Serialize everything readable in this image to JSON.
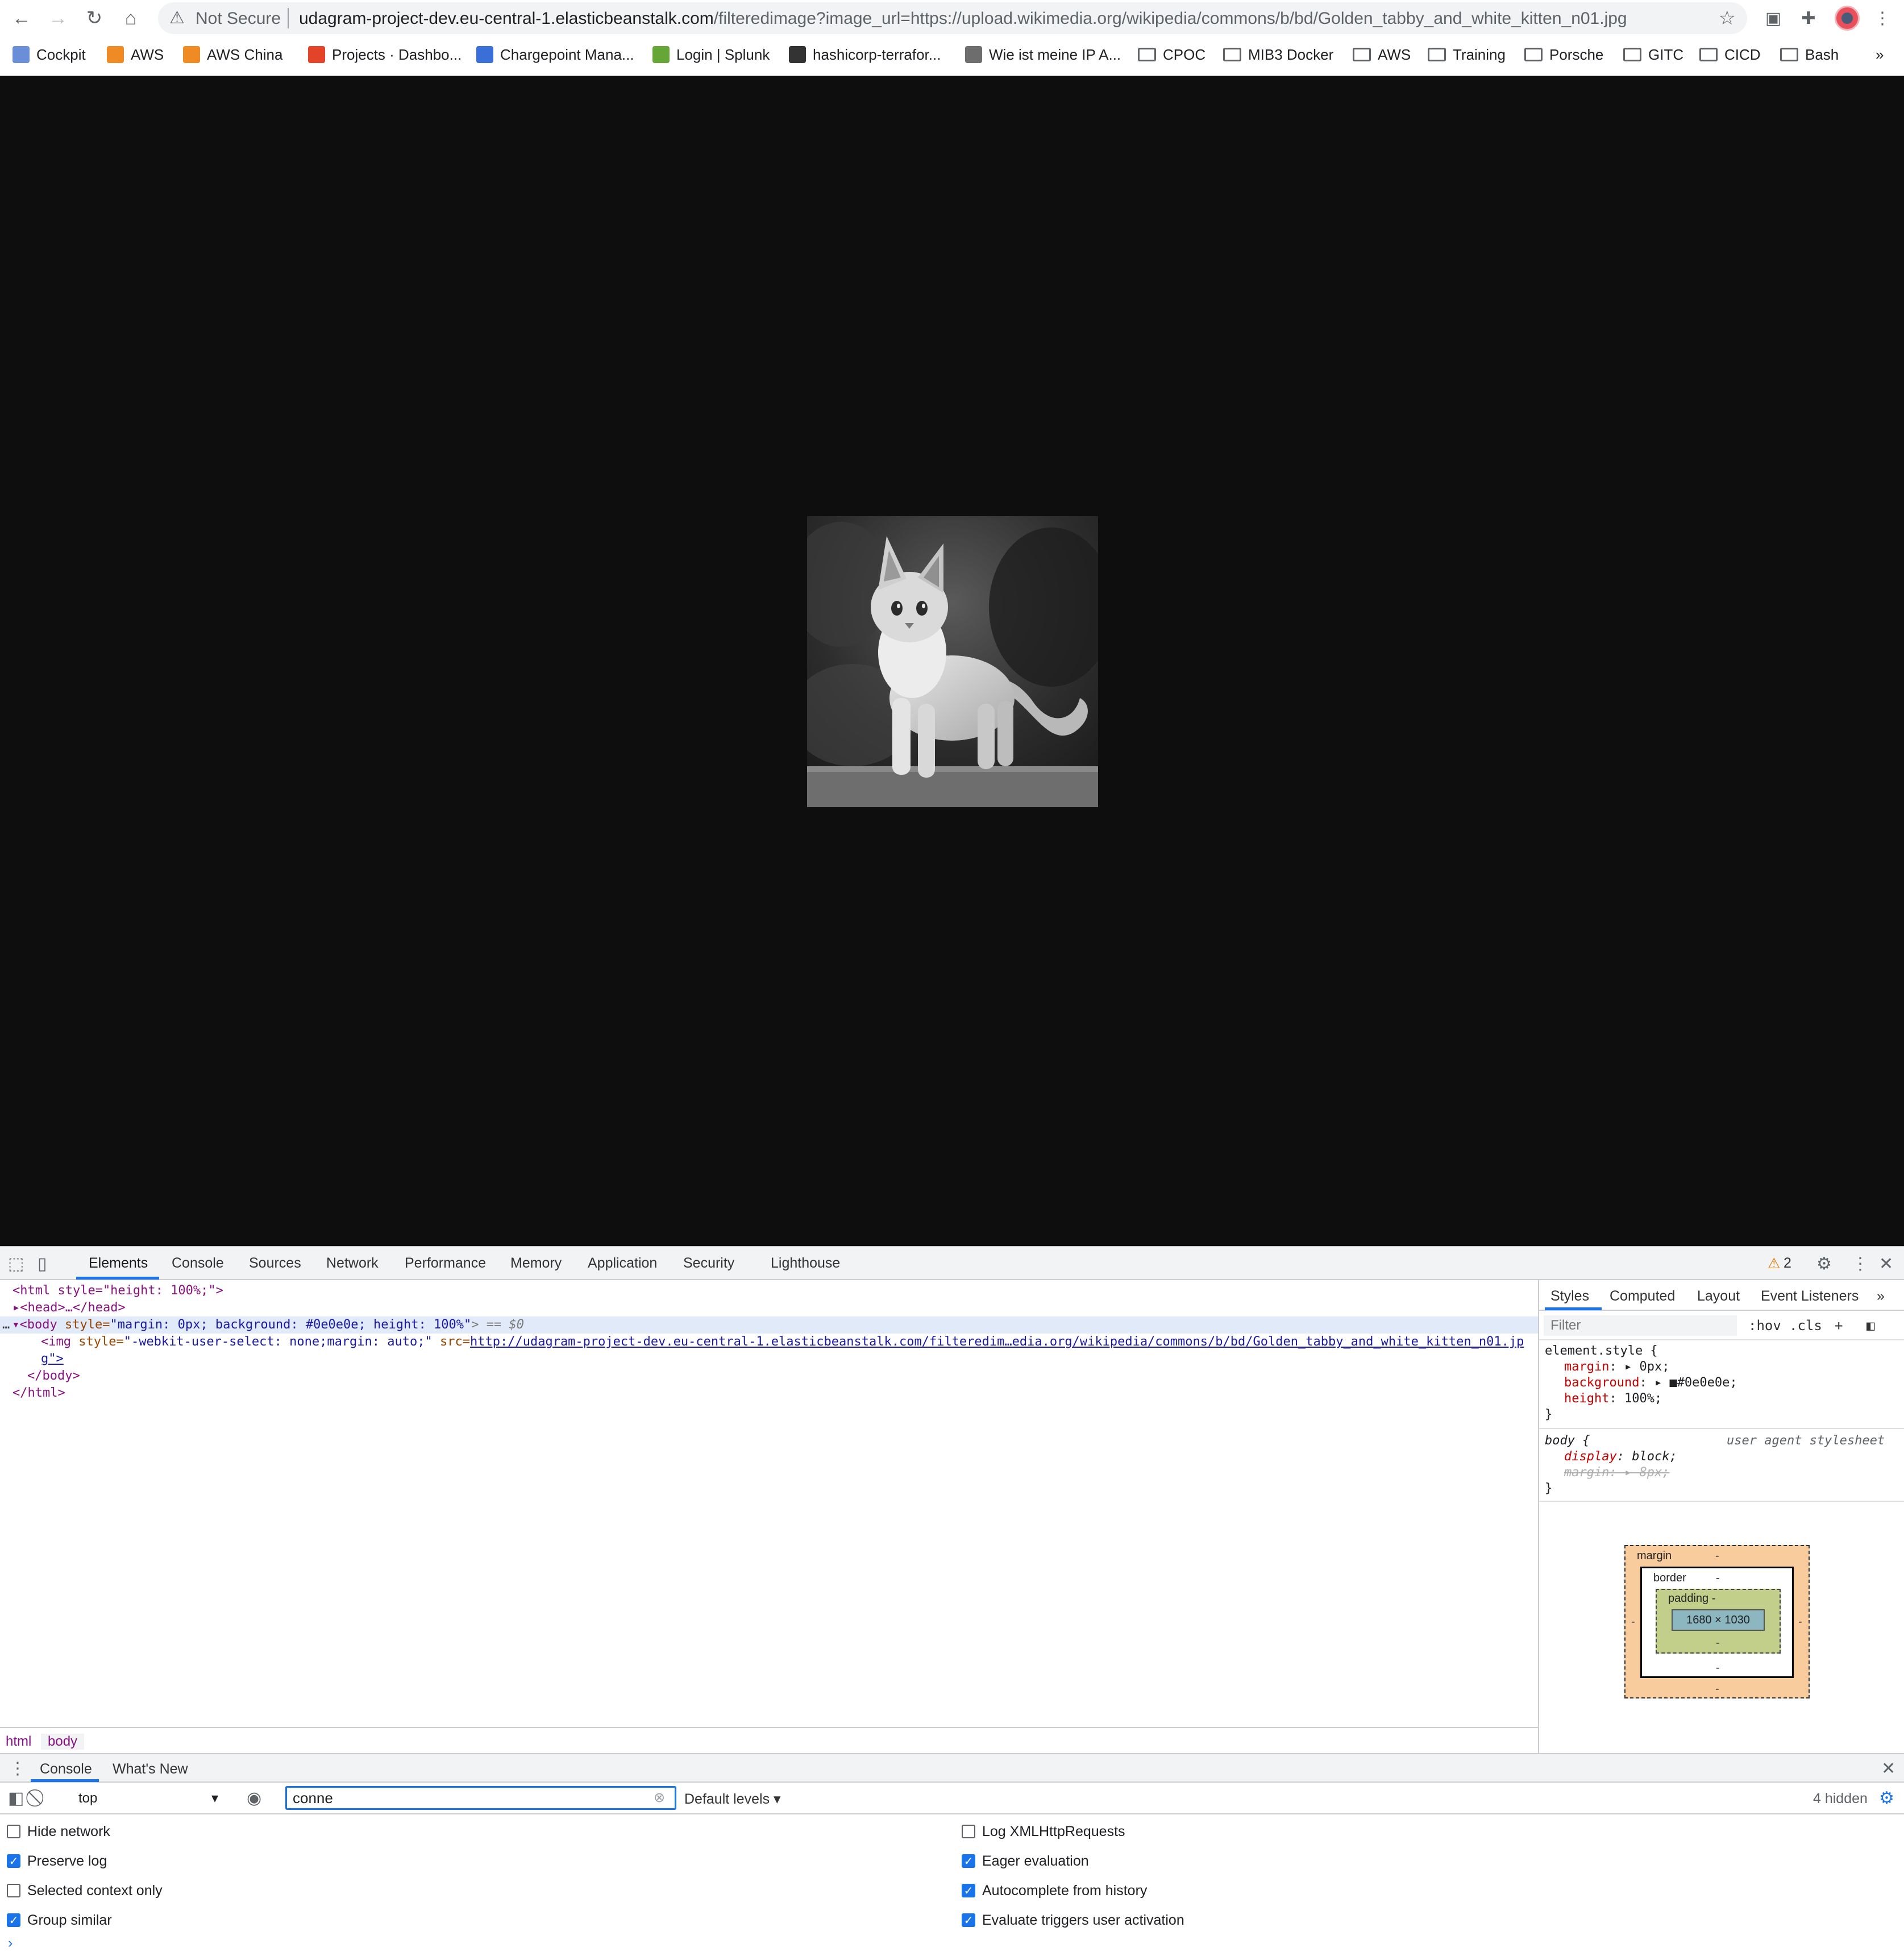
{
  "browser": {
    "security_label": "Not Secure",
    "url_host": "udagram-project-dev.eu-central-1.elasticbeanstalk.com",
    "url_rest": "/filteredimage?image_url=https://upload.wikimedia.org/wikipedia/commons/b/bd/Golden_tabby_and_white_kitten_n01.jpg",
    "bookmarks": [
      "Cockpit",
      "AWS",
      "AWS China",
      "Projects · Dashbo...",
      "Chargepoint Mana...",
      "Login | Splunk",
      "hashicorp-terrafor...",
      "Wie ist meine IP A...",
      "CPOC",
      "MIB3 Docker",
      "AWS",
      "Training",
      "Porsche",
      "GITC",
      "CICD",
      "Bash"
    ],
    "more_bookmarks": "»"
  },
  "page": {
    "background": "#0e0e0e",
    "image_alt": "Golden tabby and white kitten (grayscale)"
  },
  "devtools": {
    "tabs": [
      "Elements",
      "Console",
      "Sources",
      "Network",
      "Performance",
      "Memory",
      "Application",
      "Security",
      "Lighthouse"
    ],
    "active_tab": "Elements",
    "warnings_count": "2",
    "dom": {
      "html_open": "<html style=\"height: 100%;\">",
      "head": "<head>…</head>",
      "body_tag": "<body",
      "body_attr": " style=",
      "body_val": "\"margin: 0px; background: #0e0e0e; height: 100%\"",
      "body_suffix": "> == $0",
      "img_tag": "<img",
      "img_attr": " style=",
      "img_val": "\"-webkit-user-select: none;margin: auto;\"",
      "img_src_attr": " src=",
      "img_src": "http://udagram-project-dev.eu-central-1.elasticbeanstalk.com/filteredim…edia.org/wikipedia/commons/b/bd/Golden_tabby_and_white_kitten_n01.jp",
      "img_src_wrap": "g\">",
      "body_close": "</body>",
      "html_close": "</html>"
    },
    "breadcrumbs": [
      "html",
      "body"
    ],
    "styles": {
      "tabs": [
        "Styles",
        "Computed",
        "Layout",
        "Event Listeners",
        "»"
      ],
      "filter_placeholder": "Filter",
      "hov": ":hov",
      "cls": ".cls",
      "element_style_selector": "element.style {",
      "element_props": [
        {
          "name": "margin",
          "value": "▸ 0px;"
        },
        {
          "name": "background",
          "value": "▸ ■#0e0e0e;"
        },
        {
          "name": "height",
          "value": "100%;"
        }
      ],
      "body_selector": "body {",
      "body_source": "user agent stylesheet",
      "body_props": [
        {
          "name": "display",
          "value": "block;"
        },
        {
          "name": "margin",
          "value": "▸ 8px;"
        }
      ],
      "close_brace": "}"
    },
    "box_model": {
      "margin_label": "margin",
      "border_label": "border",
      "padding_label": "padding -",
      "dash": "-",
      "content_size": "1680 × 1030"
    },
    "drawer": {
      "tabs": [
        "Console",
        "What's New"
      ],
      "context": "top",
      "filter_value": "conne",
      "levels": "Default levels ▾",
      "hidden_count": "4 hidden",
      "settings_left": [
        {
          "label": "Hide network",
          "checked": false
        },
        {
          "label": "Preserve log",
          "checked": true
        },
        {
          "label": "Selected context only",
          "checked": false
        },
        {
          "label": "Group similar",
          "checked": true
        }
      ],
      "settings_right": [
        {
          "label": "Log XMLHttpRequests",
          "checked": false
        },
        {
          "label": "Eager evaluation",
          "checked": true
        },
        {
          "label": "Autocomplete from history",
          "checked": true
        },
        {
          "label": "Evaluate triggers user activation",
          "checked": true
        }
      ],
      "prompt": "›"
    }
  }
}
